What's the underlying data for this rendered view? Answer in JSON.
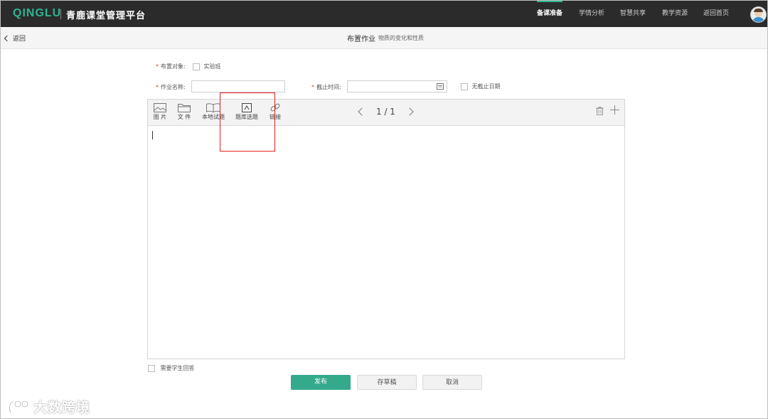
{
  "brand": {
    "logo": "QINGLU",
    "platform": "青鹿课堂管理平台",
    "accent": "#2cb591"
  },
  "nav": {
    "items": [
      {
        "label": "备课准备",
        "active": true
      },
      {
        "label": "学情分析",
        "active": false
      },
      {
        "label": "智慧共享",
        "active": false
      },
      {
        "label": "教学资源",
        "active": false
      },
      {
        "label": "返回首页",
        "active": false
      }
    ],
    "avatar": "user-avatar-icon"
  },
  "subheader": {
    "back_label": "返回",
    "title": "布置作业",
    "subtitle": "物质的变化和性质"
  },
  "form": {
    "target_label": "布置对象:",
    "target_option": "实验班",
    "name_label": "作业名称:",
    "name_value": "",
    "deadline_label": "截止时间:",
    "deadline_value": "",
    "no_deadline_label": "无截止日期",
    "required_mark": "*"
  },
  "toolbar": {
    "tools": [
      {
        "label": "图 片",
        "icon": "image-icon"
      },
      {
        "label": "文 件",
        "icon": "folder-icon"
      },
      {
        "label": "本地试题",
        "icon": "book-icon"
      },
      {
        "label": "题库选题",
        "icon": "question-bank-icon"
      },
      {
        "label": "链接",
        "icon": "link-icon"
      }
    ],
    "pager": "1 / 1"
  },
  "footer": {
    "need_answer_label": "需要学生回答",
    "publish_label": "发布",
    "draft_label": "存草稿",
    "cancel_label": "取消"
  },
  "watermark": "大数跨境",
  "colors": {
    "topbar": "#2b2b2b",
    "primary_button": "#34a98c",
    "highlight_box": "#e02020"
  }
}
